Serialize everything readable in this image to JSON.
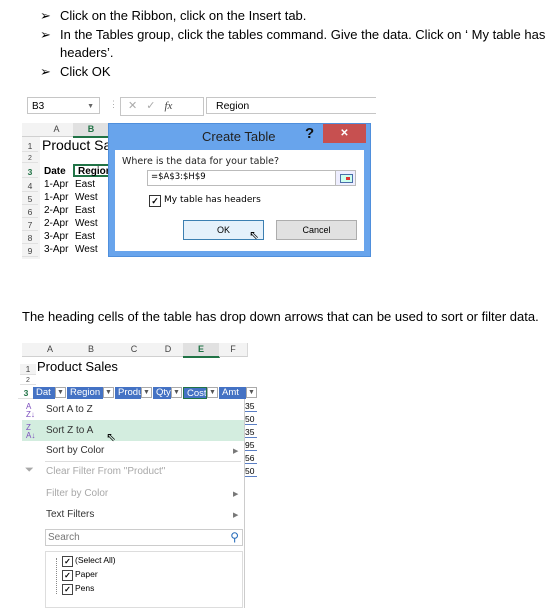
{
  "instructions": [
    "Click on the Ribbon, click on the Insert tab.",
    "In the Tables group, click the tables command. Give the data. Click on ‘ My table has",
    "headers’.",
    "Click OK"
  ],
  "shot1": {
    "name_box": "B3",
    "fx": "fx",
    "formula": "Region",
    "columns": [
      "A",
      "B"
    ],
    "rows": [
      "1",
      "2",
      "3",
      "4",
      "5",
      "6",
      "7",
      "8",
      "9"
    ],
    "title_cell": "Product Sa",
    "header_cells": [
      "Date",
      "Region"
    ],
    "data": [
      [
        "1-Apr",
        "East"
      ],
      [
        "1-Apr",
        "West"
      ],
      [
        "2-Apr",
        "East"
      ],
      [
        "2-Apr",
        "West"
      ],
      [
        "3-Apr",
        "East"
      ],
      [
        "3-Apr",
        "West"
      ]
    ],
    "dialog": {
      "title": "Create Table",
      "help": "?",
      "close": "✕",
      "prompt": "Where is the data for your table?",
      "range": "=$A$3:$H$9",
      "checkbox_label": "My table has headers",
      "checked": true,
      "ok": "OK",
      "cancel": "Cancel"
    }
  },
  "paragraph": "The heading cells of the table has drop down arrows that can be used to sort or filter data.",
  "shot2": {
    "columns": [
      "A",
      "B",
      "C",
      "D",
      "E",
      "F"
    ],
    "rows": [
      "1",
      "2",
      "3"
    ],
    "title_cell": "Product Sales",
    "headers": [
      "Dat",
      "Region",
      "Produ",
      "Qty",
      "Cost",
      "Amt"
    ],
    "amt_values": [
      "35",
      "50",
      "35",
      "95",
      "56",
      "50"
    ],
    "menu": {
      "sort_az": "Sort A to Z",
      "sort_za": "Sort Z to A",
      "sort_color": "Sort by Color",
      "clear_filter": "Clear Filter From \"Product\"",
      "filter_color": "Filter by Color",
      "text_filters": "Text Filters",
      "search_placeholder": "Search",
      "items": [
        "(Select All)",
        "Paper",
        "Pens"
      ]
    },
    "highlight_color": "#d3eddf",
    "header_color": "#4472c4"
  }
}
